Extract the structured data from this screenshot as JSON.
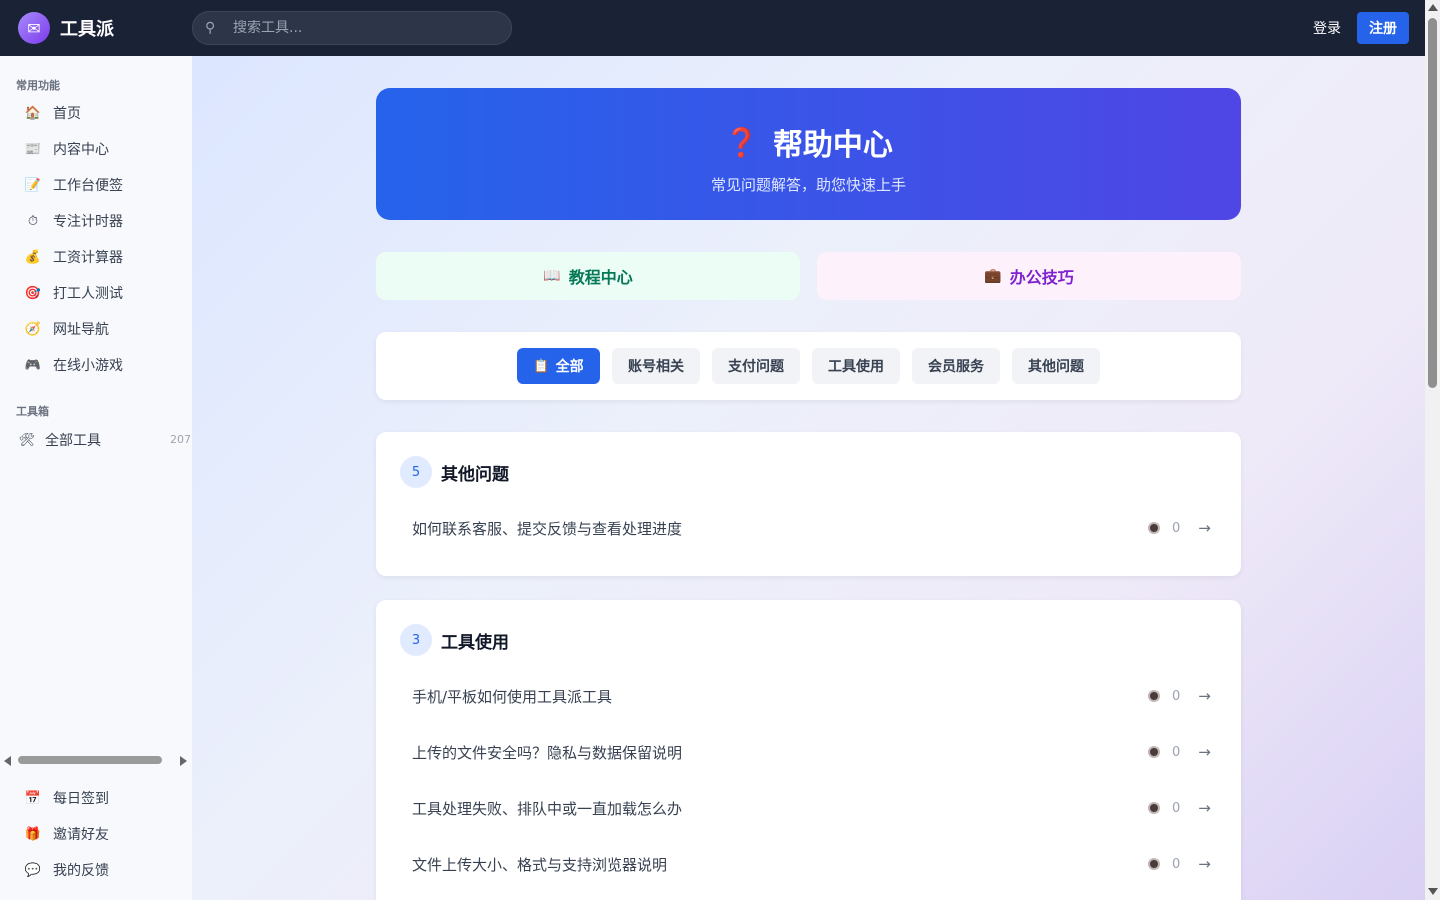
{
  "header": {
    "logo_text": "工具派",
    "search_placeholder": "搜索工具...",
    "login_label": "登录",
    "register_label": "注册"
  },
  "sidebar": {
    "section_common": "常用功能",
    "items": [
      {
        "label": "首页",
        "icon": "🏠"
      },
      {
        "label": "内容中心",
        "icon": "📰"
      },
      {
        "label": "工作台便签",
        "icon": "📝"
      },
      {
        "label": "专注计时器",
        "icon": "⏱"
      },
      {
        "label": "工资计算器",
        "icon": "💰"
      },
      {
        "label": "打工人测试",
        "icon": "🎯"
      },
      {
        "label": "网址导航",
        "icon": "🧭"
      },
      {
        "label": "在线小游戏",
        "icon": "🎮"
      }
    ],
    "section_toolbox": "工具箱",
    "all_tools": {
      "label": "全部工具",
      "icon": "🛠",
      "count": "207"
    },
    "bottom_items": [
      {
        "label": "每日签到",
        "icon": "📅"
      },
      {
        "label": "邀请好友",
        "icon": "🎁"
      },
      {
        "label": "我的反馈",
        "icon": "💬"
      }
    ]
  },
  "hero": {
    "icon": "❓",
    "title": "帮助中心",
    "subtitle": "常见问题解答，助您快速上手"
  },
  "quick_links": {
    "tutorial": {
      "icon": "📖",
      "label": "教程中心"
    },
    "office": {
      "icon": "💼",
      "label": "办公技巧"
    }
  },
  "filters": {
    "all_icon": "📋",
    "chips": [
      "全部",
      "账号相关",
      "支付问题",
      "工具使用",
      "会员服务",
      "其他问题"
    ]
  },
  "groups": [
    {
      "count": "5",
      "title": "其他问题",
      "questions": [
        {
          "text": "如何联系客服、提交反馈与查看处理进度",
          "views": "0"
        }
      ]
    },
    {
      "count": "3",
      "title": "工具使用",
      "questions": [
        {
          "text": "手机/平板如何使用工具派工具",
          "views": "0"
        },
        {
          "text": "上传的文件安全吗？隐私与数据保留说明",
          "views": "0"
        },
        {
          "text": "工具处理失败、排队中或一直加载怎么办",
          "views": "0"
        },
        {
          "text": "文件上传大小、格式与支持浏览器说明",
          "views": "0"
        }
      ]
    }
  ],
  "arrow_glyph": "→",
  "colors": {
    "accent": "#2563eb",
    "topbar": "#1a2236",
    "hero_start": "#2563eb",
    "hero_end": "#4f46e5"
  }
}
